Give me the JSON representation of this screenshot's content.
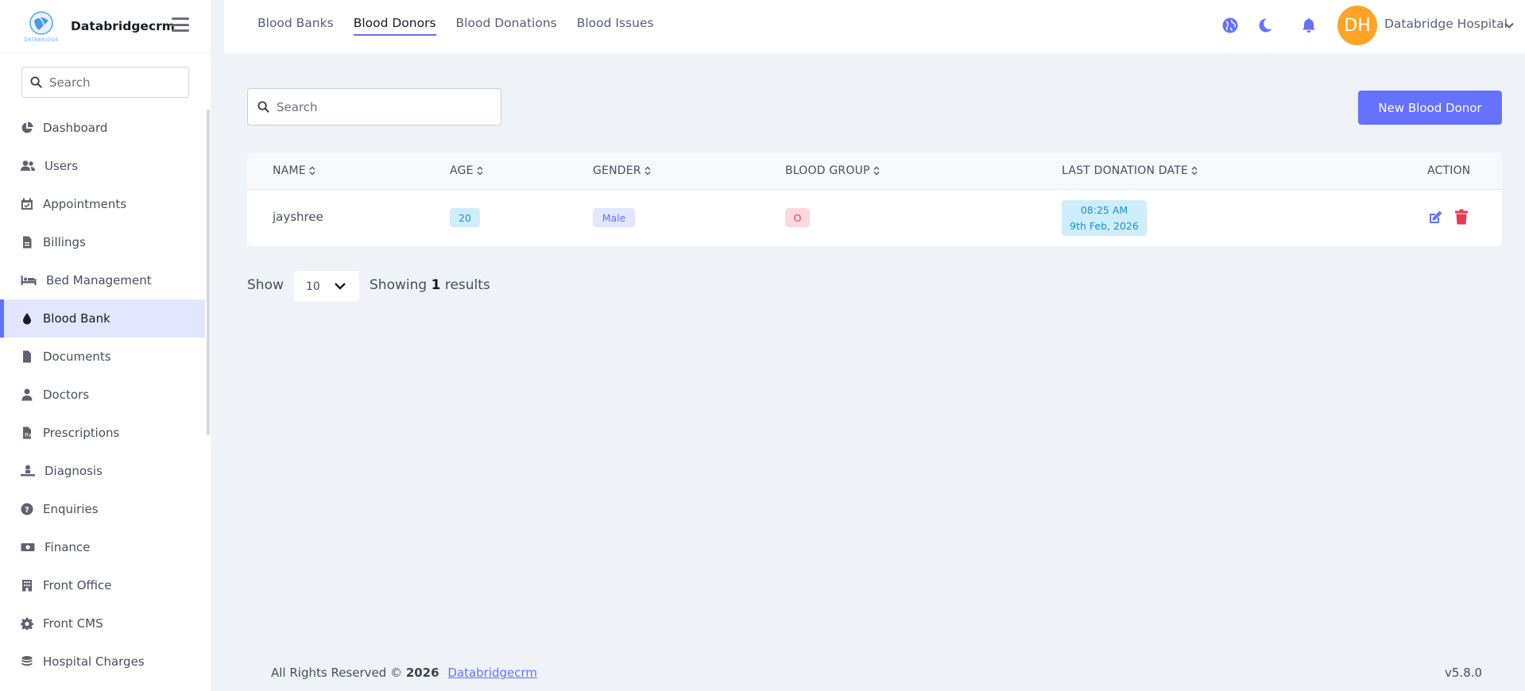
{
  "app": {
    "brand_name": "Databridgecrm",
    "logo_text": "DATABRIDGE"
  },
  "sidebar": {
    "search_placeholder": "Search",
    "items": [
      {
        "label": "Dashboard",
        "icon": "pie-chart-icon"
      },
      {
        "label": "Users",
        "icon": "users-icon"
      },
      {
        "label": "Appointments",
        "icon": "calendar-check-icon"
      },
      {
        "label": "Billings",
        "icon": "file-invoice-icon"
      },
      {
        "label": "Bed Management",
        "icon": "bed-icon"
      },
      {
        "label": "Blood Bank",
        "icon": "droplet-icon",
        "active": true
      },
      {
        "label": "Documents",
        "icon": "file-icon"
      },
      {
        "label": "Doctors",
        "icon": "user-doctor-icon"
      },
      {
        "label": "Prescriptions",
        "icon": "prescription-icon"
      },
      {
        "label": "Diagnosis",
        "icon": "diagnosis-icon"
      },
      {
        "label": "Enquiries",
        "icon": "question-circle-icon"
      },
      {
        "label": "Finance",
        "icon": "money-bill-icon"
      },
      {
        "label": "Front Office",
        "icon": "building-icon"
      },
      {
        "label": "Front CMS",
        "icon": "gear-icon"
      },
      {
        "label": "Hospital Charges",
        "icon": "coins-icon"
      }
    ]
  },
  "topbar": {
    "tabs": [
      {
        "label": "Blood Banks"
      },
      {
        "label": "Blood Donors",
        "active": true
      },
      {
        "label": "Blood Donations"
      },
      {
        "label": "Blood Issues"
      }
    ],
    "user": {
      "initials": "DH",
      "name": "Databridge Hospital"
    },
    "accent_color": "#6571ff",
    "avatar_color": "#ffa427"
  },
  "main": {
    "search_placeholder": "Search",
    "new_button_label": "New Blood Donor",
    "table": {
      "columns": [
        {
          "label": "NAME",
          "sortable": true
        },
        {
          "label": "AGE",
          "sortable": true
        },
        {
          "label": "GENDER",
          "sortable": true
        },
        {
          "label": "BLOOD GROUP",
          "sortable": true
        },
        {
          "label": "LAST DONATION DATE",
          "sortable": true
        },
        {
          "label": "ACTION",
          "sortable": false
        }
      ],
      "rows": [
        {
          "name": "jayshree",
          "age": "20",
          "gender": "Male",
          "blood_group": "O",
          "last_donation_time": "08:25 AM",
          "last_donation_date": "9th Feb, 2026"
        }
      ]
    },
    "pagination": {
      "show_label": "Show",
      "per_page": "10",
      "showing_prefix": "Showing",
      "showing_count": "1",
      "showing_suffix": "results"
    }
  },
  "footer": {
    "copyright": "All Rights Reserved ©",
    "year": "2026",
    "link_text": "Databridgecrm",
    "version": "v5.8.0"
  }
}
